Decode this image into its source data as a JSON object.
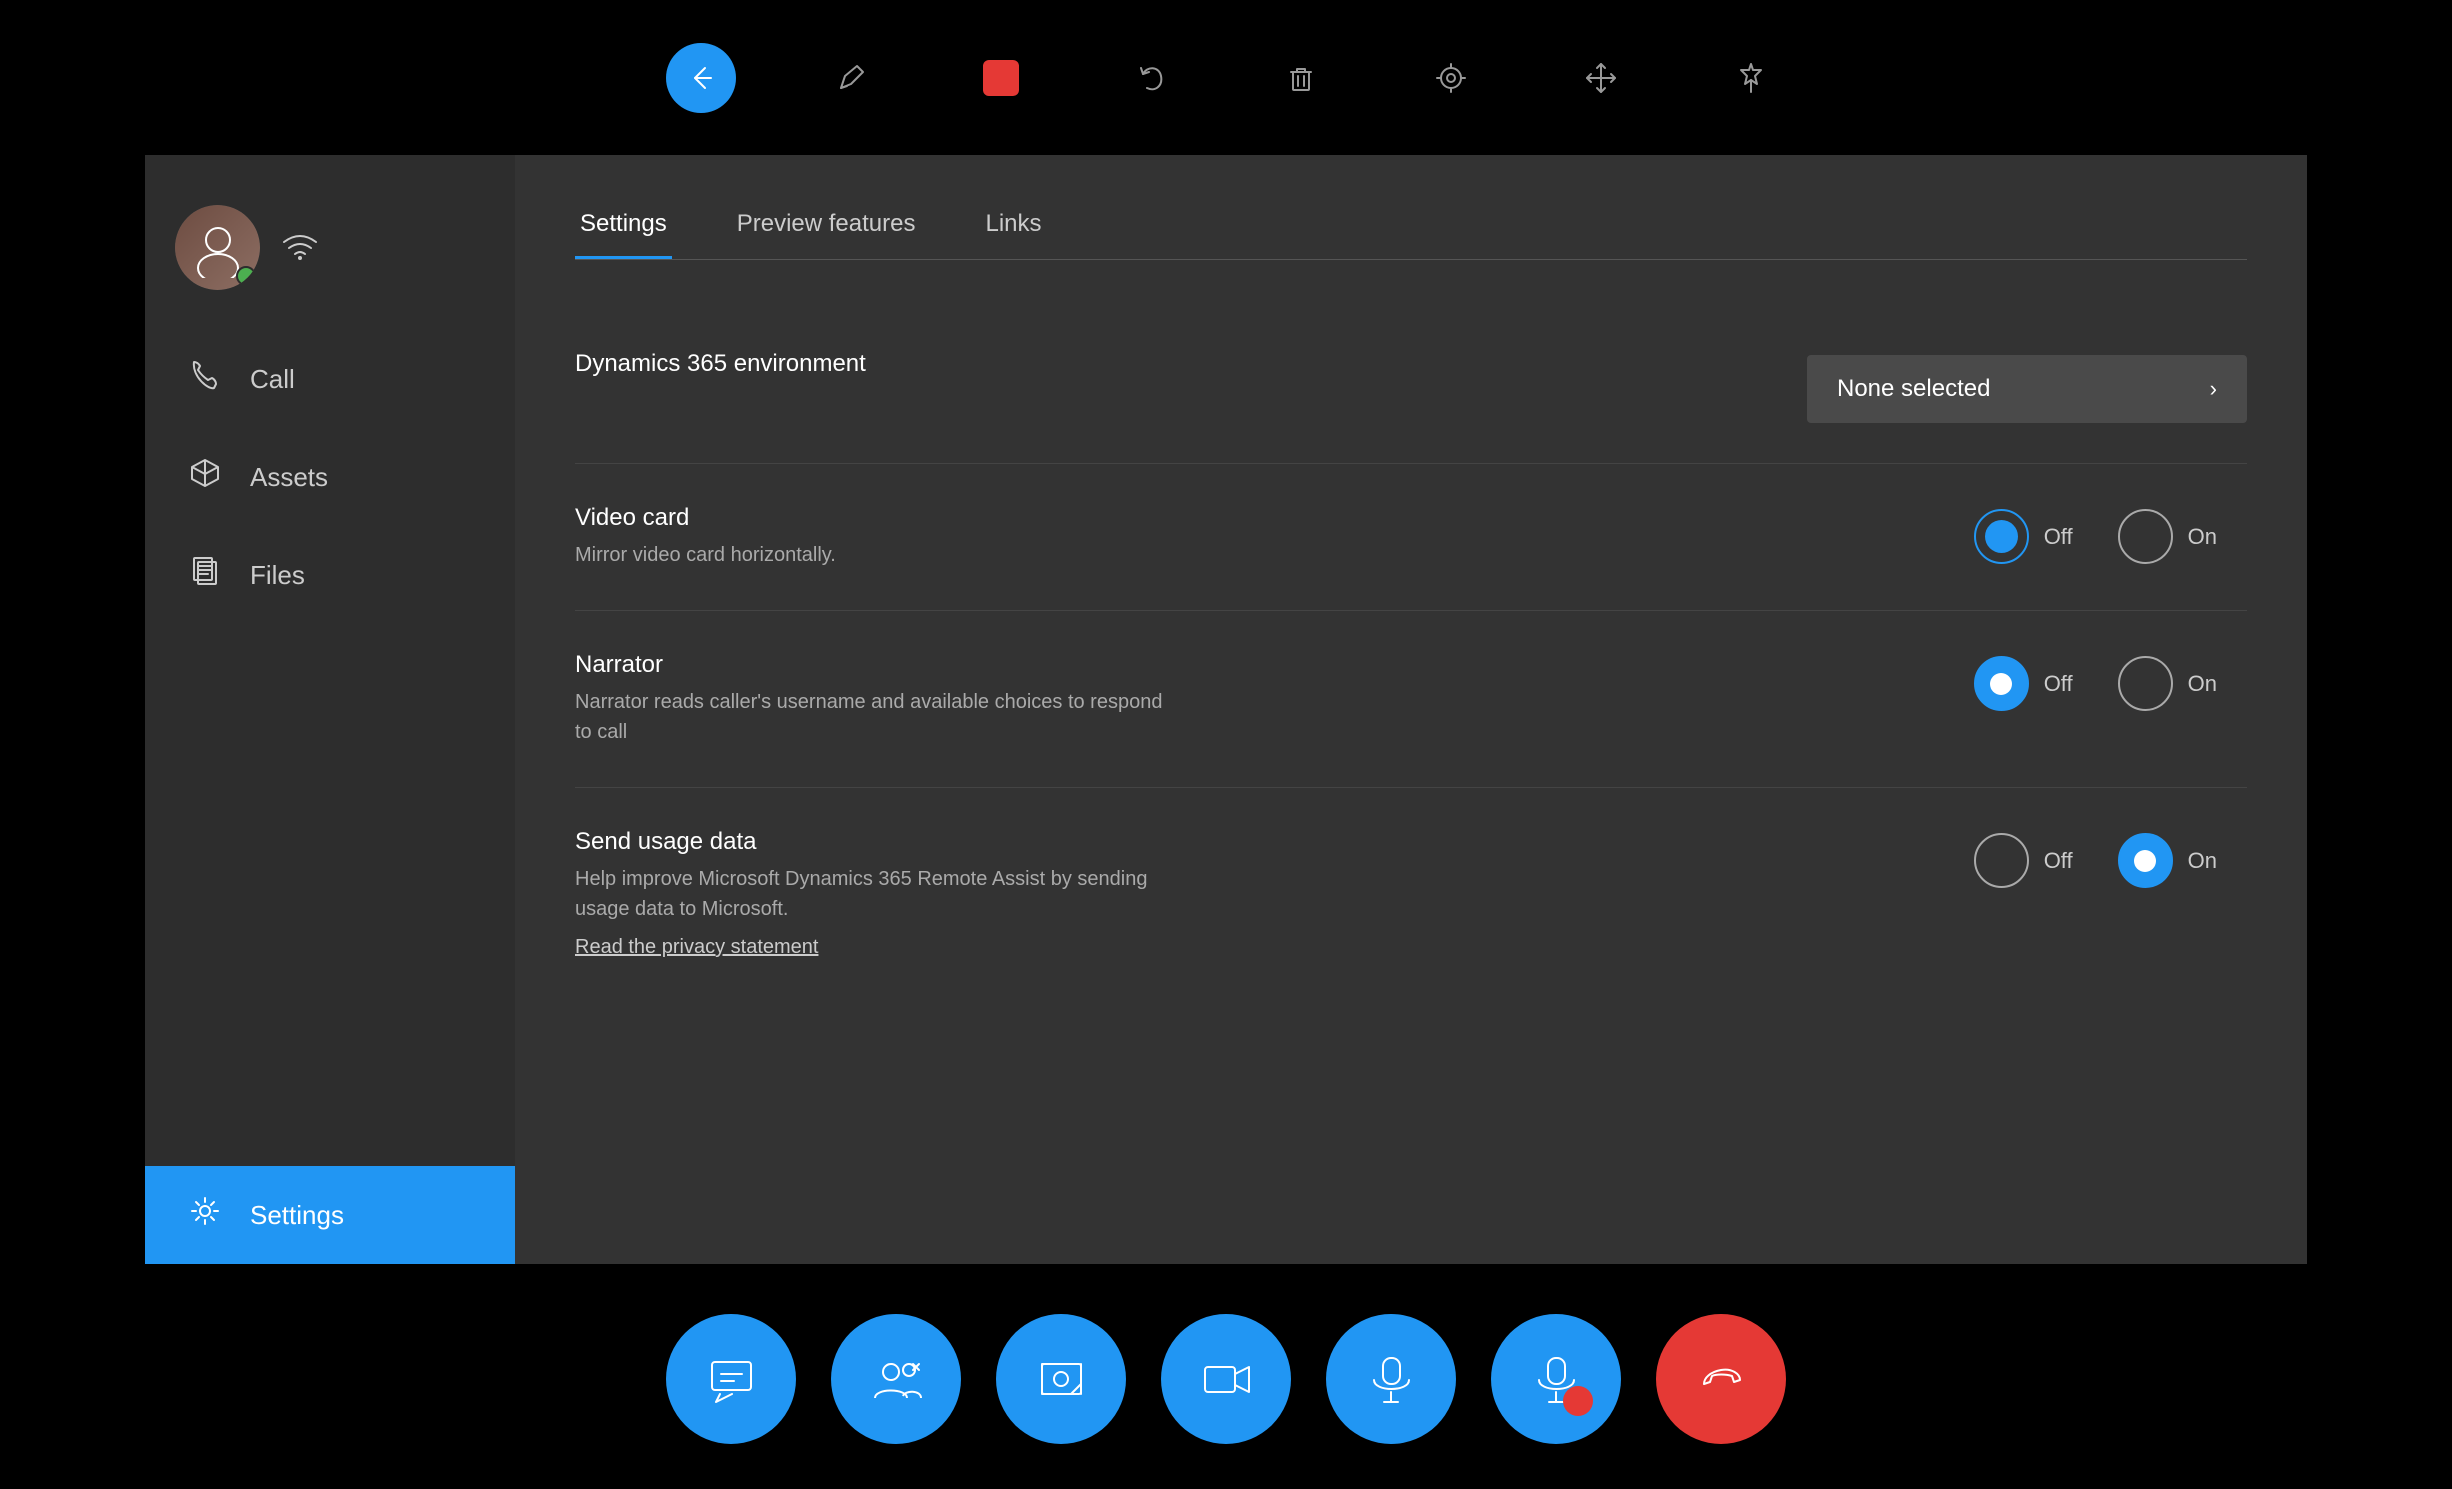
{
  "toolbar": {
    "back_icon": "←",
    "pen_icon": "✏",
    "record_icon": "⬛",
    "undo_icon": "↩",
    "trash_icon": "🗑",
    "target_icon": "⊙",
    "move_icon": "✛",
    "pin_icon": "📌"
  },
  "sidebar": {
    "user_initial": "👤",
    "nav_items": [
      {
        "id": "call",
        "label": "Call",
        "icon": "phone"
      },
      {
        "id": "assets",
        "label": "Assets",
        "icon": "cube"
      },
      {
        "id": "files",
        "label": "Files",
        "icon": "file"
      },
      {
        "id": "settings",
        "label": "Settings",
        "icon": "gear",
        "active": true
      }
    ]
  },
  "tabs": [
    {
      "id": "settings",
      "label": "Settings",
      "active": true
    },
    {
      "id": "preview",
      "label": "Preview features",
      "active": false
    },
    {
      "id": "links",
      "label": "Links",
      "active": false
    }
  ],
  "settings": {
    "dynamics_label": "Dynamics 365 environment",
    "dynamics_value": "None selected",
    "video_card": {
      "title": "Video card",
      "desc": "Mirror video card horizontally.",
      "off_selected": true,
      "on_selected": false
    },
    "narrator": {
      "title": "Narrator",
      "desc": "Narrator reads caller's username and available choices to respond to call",
      "off_selected": true,
      "on_selected": false
    },
    "send_usage": {
      "title": "Send usage data",
      "desc": "Help improve Microsoft Dynamics 365 Remote Assist by sending usage data to Microsoft.",
      "off_selected": false,
      "on_selected": true,
      "privacy_link": "Read the privacy statement"
    }
  },
  "bottom_toolbar": {
    "chat": "chat",
    "participants": "participants",
    "screenshot": "screenshot",
    "video": "video",
    "mic": "mic",
    "record": "record",
    "hangup": "hangup"
  },
  "labels": {
    "off": "Off",
    "on": "On"
  }
}
